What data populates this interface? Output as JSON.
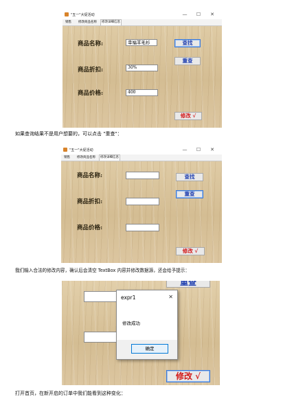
{
  "window": {
    "title": "\"五一\"大促活动",
    "tabs": [
      "销售",
      "修改商品名称",
      "修改详细信息"
    ],
    "active_tab_index": 2,
    "controls": {
      "minimize": "—",
      "maximize": "☐",
      "close": "✕"
    }
  },
  "form_labels": {
    "name": "商品名称:",
    "discount": "商品折扣:",
    "price": "商品价格:"
  },
  "buttons": {
    "search": "查找",
    "reset": "重查",
    "modify": "修改 √"
  },
  "screenshot1": {
    "name_value": "幸福羊毛衫",
    "discount_value": "30%",
    "price_value": "400"
  },
  "screenshot2": {
    "name_value": "",
    "discount_value": "",
    "price_value": ""
  },
  "paragraphs": {
    "p1": "如果查询结果不是用户想要的，可以点击 \"重查\"：",
    "p2": "我们输入合法的修改内容，确认后会清空 TextBox 内容并修改数据源，还会给予提示：",
    "p3": "打开首页，在新开启的订单中我们能看到这种变化："
  },
  "dialog": {
    "title": "expr1",
    "message": "修改成功",
    "ok": "确定",
    "close": "✕"
  }
}
